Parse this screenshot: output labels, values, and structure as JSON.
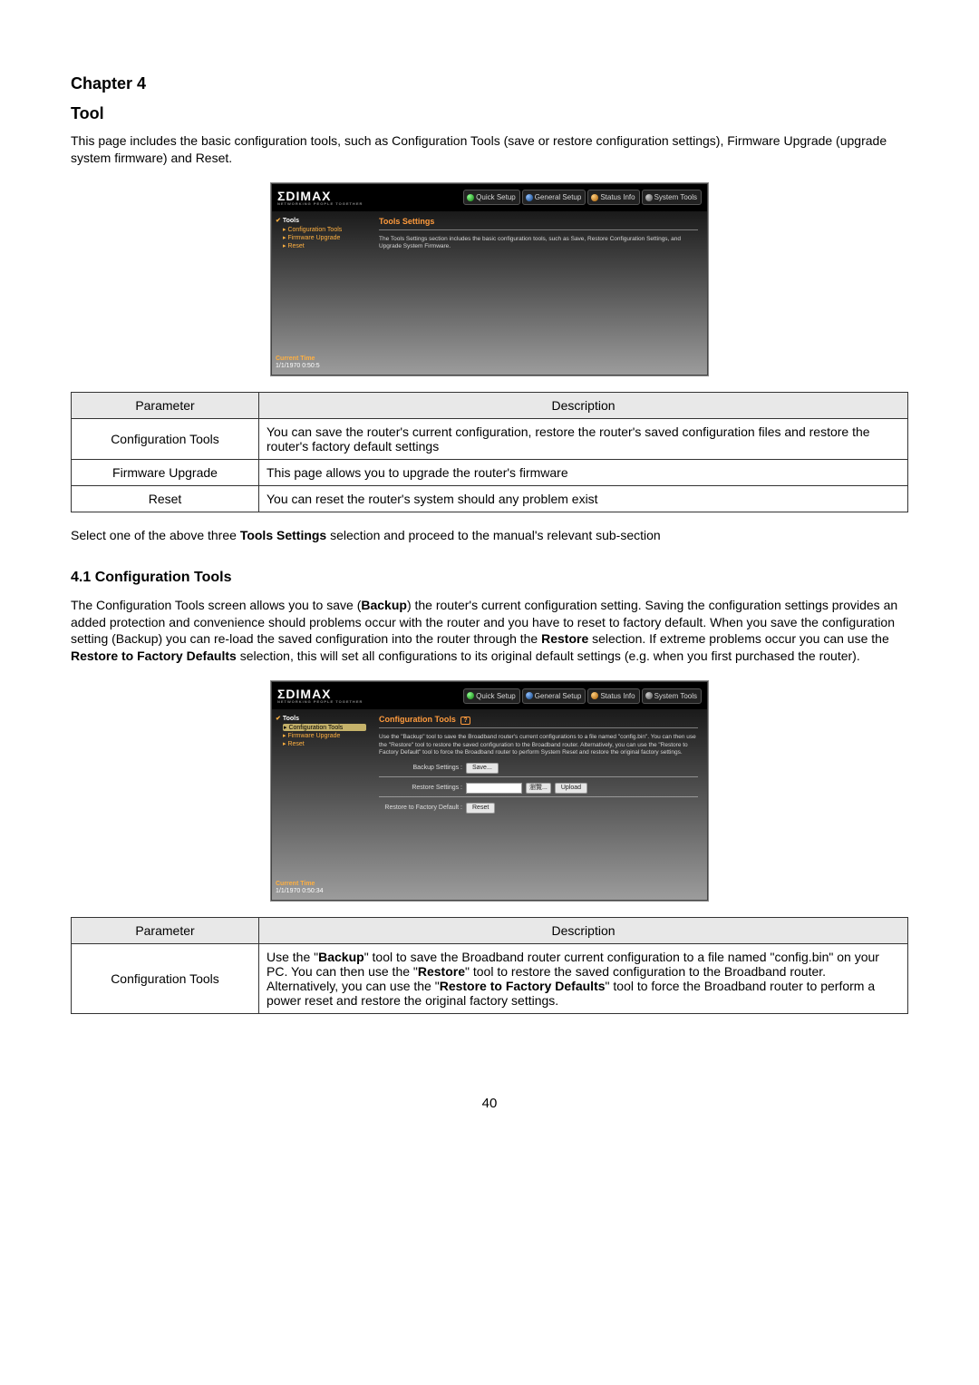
{
  "chapter": "Chapter 4",
  "section_title": "Tool",
  "intro": "This page includes the basic configuration tools, such as Configuration Tools (save or restore configuration settings), Firmware Upgrade (upgrade system firmware) and Reset.",
  "screenshot1": {
    "brand_logo": "ΣDIMAX",
    "brand_tag": "NETWORKING PEOPLE TOGETHER",
    "topnav": {
      "quick": "Quick Setup",
      "general": "General Setup",
      "status": "Status Info",
      "system": "System Tools"
    },
    "sidebar": {
      "root": "Tools",
      "items": [
        "Configuration Tools",
        "Firmware Upgrade",
        "Reset"
      ],
      "current_time_label": "Current Time",
      "current_time_value": "1/1/1970 0:50:5"
    },
    "content": {
      "title": "Tools Settings",
      "desc": "The Tools Settings section includes the basic configuration tools, such as Save, Restore Configuration Settings, and Upgrade System Firmware."
    }
  },
  "table1": {
    "head_param": "Parameter",
    "head_desc": "Description",
    "rows": [
      {
        "param": "Configuration Tools",
        "desc": "You can save the router's current configuration, restore the router's saved configuration files and restore the router's factory default settings"
      },
      {
        "param": "Firmware Upgrade",
        "desc": "This page allows you to upgrade the router's firmware"
      },
      {
        "param": "Reset",
        "desc": "You can reset the router's system should any problem exist"
      }
    ]
  },
  "mid_note": {
    "pre": "Select one of the above three ",
    "bold": "Tools Settings",
    "post": " selection and proceed to the manual's relevant sub-section"
  },
  "subsection": "4.1 Configuration Tools",
  "subsection_body": {
    "t1": "The Configuration Tools screen allows you to save (",
    "b1": "Backup",
    "t2": ") the router's current configuration setting. Saving the configuration settings provides an added protection and convenience should problems occur with the router and you have to reset to factory default. When you save the configuration setting (Backup) you can re-load the saved configuration into the router through the ",
    "b2": "Restore",
    "t3": " selection. If extreme problems occur you can use the ",
    "b3": "Restore to Factory Defaults",
    "t4": " selection, this will set all configurations to its original default settings (e.g. when you first purchased the router)."
  },
  "screenshot2": {
    "sidebar": {
      "root": "Tools",
      "items": [
        "Configuration Tools",
        "Firmware Upgrade",
        "Reset"
      ],
      "current_time_label": "Current Time",
      "current_time_value": "1/1/1970 0:50:34"
    },
    "content": {
      "title": "Configuration Tools",
      "help": "?",
      "desc": "Use the \"Backup\" tool to save the Broadband router's current configurations to a file named \"config.bin\". You can then use the \"Restore\" tool to restore the saved configuration to the Broadband router. Alternatively, you can use the \"Restore to Factory Default\" tool to force the Broadband router to perform System Reset and restore the original factory settings.",
      "rows": {
        "backup_label": "Backup Settings :",
        "backup_button": "Save...",
        "restore_label": "Restore Settings :",
        "browse_button": "瀏覽...",
        "upload_button": "Upload",
        "factory_label": "Restore to Factory Default :",
        "reset_button": "Reset"
      }
    }
  },
  "table2": {
    "head_param": "Parameter",
    "head_desc": "Description",
    "row": {
      "param": "Configuration Tools",
      "d1": "Use the \"",
      "b1": "Backup",
      "d2": "\" tool to save the Broadband router current configuration to a file named \"config.bin\" on your PC. You can then use the \"",
      "b2": "Restore",
      "d3": "\" tool to restore the saved configuration to the Broadband router. Alternatively, you can use the \"",
      "b3": "Restore to Factory Defaults",
      "d4": "\" tool to force the Broadband router to perform a power reset and restore the original factory settings."
    }
  },
  "page_number": "40"
}
